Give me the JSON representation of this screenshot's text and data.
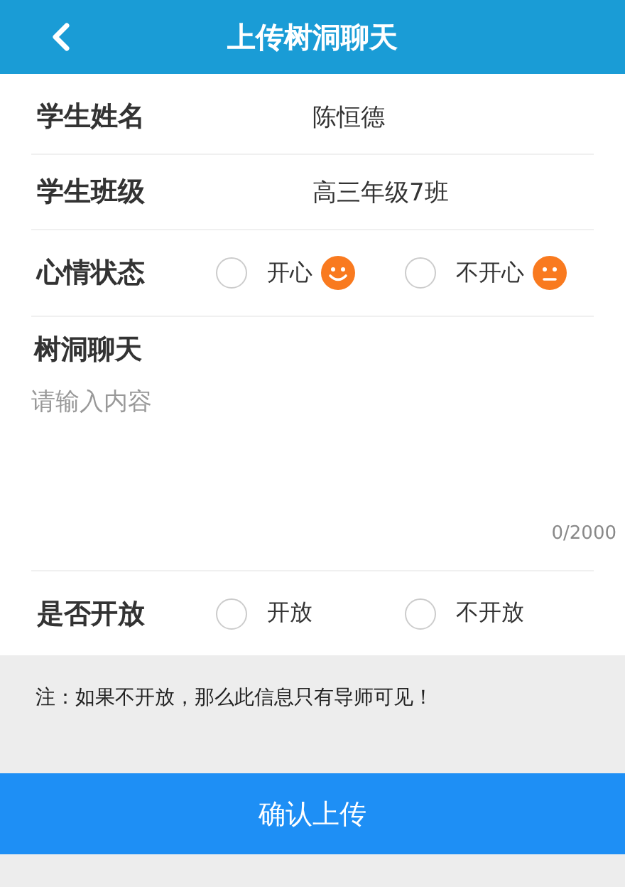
{
  "header": {
    "title": "上传树洞聊天"
  },
  "fields": [
    {
      "label": "学生姓名",
      "value": "陈恒德"
    },
    {
      "label": "学生班级",
      "value": "高三年级7班"
    }
  ],
  "mood": {
    "label": "心情状态",
    "options": [
      {
        "label": "开心",
        "kind": "happy",
        "selected": false
      },
      {
        "label": "不开心",
        "kind": "sad",
        "selected": false
      }
    ]
  },
  "chat": {
    "label": "树洞聊天",
    "placeholder": "请输入内容",
    "counter": "0/2000"
  },
  "visibility": {
    "label": "是否开放",
    "options": [
      {
        "label": "开放",
        "selected": false
      },
      {
        "label": "不开放",
        "selected": false
      }
    ]
  },
  "note": "注：如果不开放，那么此信息只有导师可见！",
  "submit": "确认上传"
}
